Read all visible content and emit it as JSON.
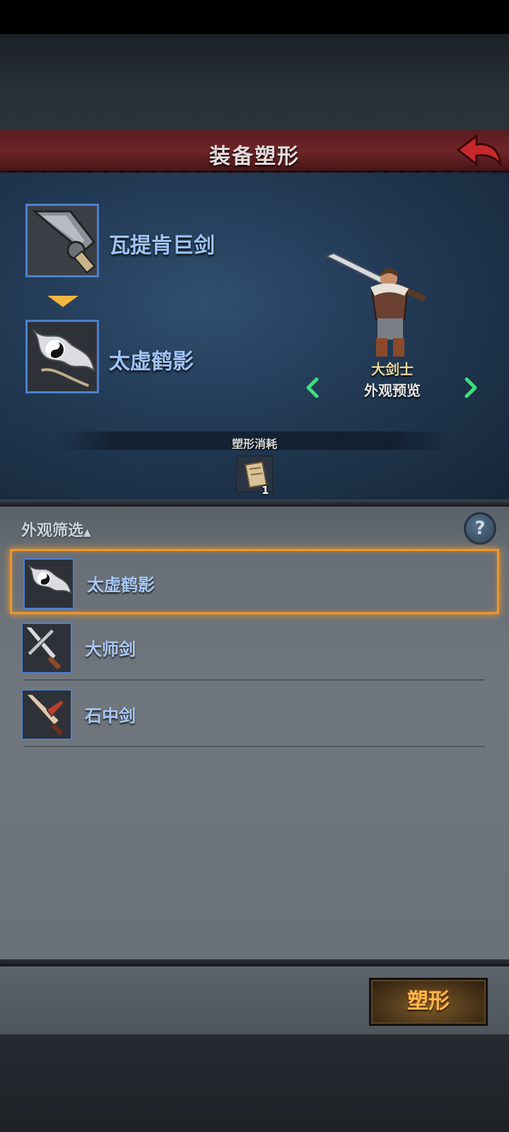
{
  "header": {
    "title": "装备塑形"
  },
  "source_item": {
    "name": "瓦提肯巨剑"
  },
  "target_item": {
    "name": "太虚鹤影"
  },
  "preview": {
    "class_name": "大剑士",
    "label": "外观预览"
  },
  "cost": {
    "label": "塑形消耗",
    "count": "1"
  },
  "filter": {
    "label": "外观筛选",
    "arrow": "▲",
    "help_glyph": "?"
  },
  "list": {
    "items": [
      {
        "name": "太虚鹤影",
        "selected": true
      },
      {
        "name": "大师剑",
        "selected": false
      },
      {
        "name": "石中剑",
        "selected": false
      }
    ]
  },
  "actions": {
    "reshape_label": "塑形"
  },
  "colors": {
    "title_bar": "#6e2528",
    "accent_blue": "#4e7fcf",
    "selection": "#f0962a",
    "button_text": "#ffb64a"
  }
}
